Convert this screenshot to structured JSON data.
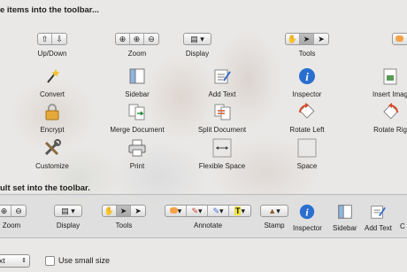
{
  "headings": {
    "available": "e items into the toolbar...",
    "default_set": "ult set into the toolbar."
  },
  "items": {
    "updown": "Up/Down",
    "zoom": "Zoom",
    "display": "Display",
    "tools": "Tools",
    "convert": "Convert",
    "sidebar": "Sidebar",
    "add_text": "Add Text",
    "inspector": "Inspector",
    "insert_image": "Insert Imag",
    "encrypt": "Encrypt",
    "merge_document": "Merge Document",
    "split_document": "Split Document",
    "rotate_left": "Rotate Left",
    "rotate_right": "Rotate Rig",
    "customize": "Customize",
    "print": "Print",
    "flexible_space": "Flexible Space",
    "space": "Space"
  },
  "default_strip": {
    "zoom": "Zoom",
    "display": "Display",
    "tools": "Tools",
    "annotate": "Annotate",
    "stamp": "Stamp",
    "inspector": "Inspector",
    "sidebar": "Sidebar",
    "add_text": "Add Text",
    "partial": "C"
  },
  "bottom": {
    "show_select_value": "xt",
    "use_small_size": "Use small size",
    "use_small_size_checked": false
  },
  "colors": {
    "pane": "#eeeeee",
    "inspector_blue": "#2a6fd0",
    "highlight_yellow": "#f1e23a"
  }
}
